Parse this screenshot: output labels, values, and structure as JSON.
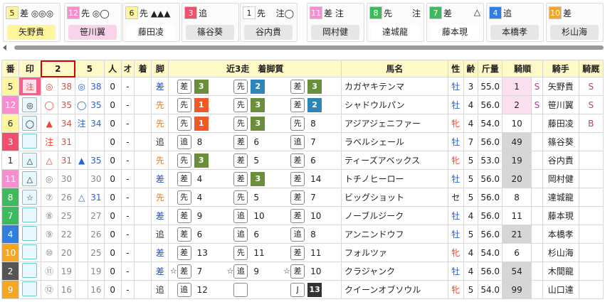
{
  "cards": [
    {
      "num": "5",
      "num_color": "#fff59d",
      "marks": "差 ◎◎◎",
      "jockey": "矢野貴",
      "jockey_bg": "#fff59d",
      "right": ""
    },
    {
      "num": "12",
      "num_color": "#f88ed0",
      "marks": "先 ◎◯",
      "jockey": "笹川翼",
      "jockey_bg": "#f9d3ea",
      "right": ""
    },
    {
      "num": "6",
      "num_color": "#fff59d",
      "marks": "先 ▲▲▲",
      "jockey": "藤田凌",
      "jockey_bg": "#fff",
      "right": ""
    },
    {
      "num": "3",
      "num_color": "#f0506e",
      "marks": "追",
      "jockey": "篠谷葵",
      "jockey_bg": "#e6e6e6",
      "right": ""
    },
    {
      "num": "1",
      "num_color": "#fff",
      "marks": "先",
      "jockey": "谷内貴",
      "jockey_bg": "#e6e6e6",
      "right": "注◯"
    },
    {
      "num": "11",
      "num_color": "#f88ed0",
      "marks": "差 注",
      "jockey": "岡村健",
      "jockey_bg": "#e6e6e6",
      "right": ""
    },
    {
      "num": "8",
      "num_color": "#3dbb5c",
      "marks": "先",
      "jockey": "達城龍",
      "jockey_bg": "#fff",
      "right": "注"
    },
    {
      "num": "7",
      "num_color": "#3dbb5c",
      "marks": "差",
      "jockey": "藤本現",
      "jockey_bg": "#fff",
      "right": "△"
    },
    {
      "num": "4",
      "num_color": "#2f7ee0",
      "marks": "追",
      "jockey": "本橋孝",
      "jockey_bg": "#e6e6e6",
      "right": ""
    },
    {
      "num": "10",
      "num_color": "#f5a623",
      "marks": "差",
      "jockey": "杉山海",
      "jockey_bg": "#e6e6e6",
      "right": ""
    }
  ],
  "headers": {
    "ban": "番",
    "shirushi": "印",
    "c2": "2",
    "c4": "",
    "c5": "5",
    "c6": "",
    "ninki": "人",
    "o": "オ",
    "chaku": "着",
    "kyaku": "脚",
    "kinsou": "近3走　着脚質",
    "bamei": "馬名",
    "sei": "性",
    "rei": "齢",
    "kinryo": "斤量",
    "kijun": "騎順",
    "kishu": "騎手",
    "kiyu": "騎厩"
  },
  "rows": [
    {
      "ban": "5",
      "ban_bg": "#fff59d",
      "ban_fg": "#222",
      "shirushi": "注",
      "shirushi_cls": "red",
      "shirushi_bg": "#ff5a8a",
      "m1": "◎",
      "m1c": "red",
      "v1": "38",
      "v1c": "red",
      "m2": "◎",
      "m2c": "blue",
      "v2": "38",
      "v2c": "blue",
      "ninki": "0",
      "o": "-",
      "kyaku": "差",
      "kyakuc": "kyaku-sa",
      "r": [
        {
          "st": "",
          "k": "差",
          "b": "3",
          "bc": "b-sa"
        },
        {
          "st": "",
          "k": "先",
          "b": "2",
          "bc": "b-zai"
        },
        {
          "st": "",
          "k": "差",
          "b": "3",
          "bc": "b-sa"
        }
      ],
      "bamei": "カガヤキテンマ",
      "sei": "牡",
      "seic": "blue",
      "rei": "3",
      "kinryo": "55.0",
      "kijun": "1",
      "kijunbg": "#fde0f0",
      "s": "S",
      "kishu": "矢野貴",
      "kiyu": "S"
    },
    {
      "ban": "12",
      "ban_bg": "#f88ed0",
      "ban_fg": "#fff",
      "shirushi": "◎",
      "shirushi_cls": "",
      "shirushi_bg": "#fff",
      "m1": "◯",
      "m1c": "red",
      "v1": "35",
      "v1c": "red",
      "m2": "◯",
      "m2c": "blue",
      "v2": "35",
      "v2c": "blue",
      "ninki": "0",
      "o": "-",
      "kyaku": "先",
      "kyakuc": "kyaku-se",
      "r": [
        {
          "st": "",
          "k": "先",
          "b": "1",
          "bc": "b-se"
        },
        {
          "st": "",
          "k": "先",
          "b": "3",
          "bc": "b-sa"
        },
        {
          "st": "",
          "k": "差",
          "b": "2",
          "bc": "b-zai"
        }
      ],
      "bamei": "シャドウルパン",
      "sei": "牡",
      "seic": "blue",
      "rei": "4",
      "kinryo": "56.0",
      "kijun": "2",
      "kijunbg": "#fde0f0",
      "s": "S",
      "kishu": "笹川翼",
      "kiyu": "S"
    },
    {
      "ban": "6",
      "ban_bg": "#fff59d",
      "ban_fg": "#222",
      "shirushi": "◯",
      "shirushi_cls": "",
      "shirushi_bg": "#fff",
      "m1": "▲",
      "m1c": "red",
      "v1": "34",
      "v1c": "red",
      "m2": "注",
      "m2c": "blue",
      "v2": "34",
      "v2c": "blue",
      "ninki": "0",
      "o": "-",
      "kyaku": "先",
      "kyakuc": "kyaku-se",
      "r": [
        {
          "st": "",
          "k": "先",
          "b": "1",
          "bc": "b-se"
        },
        {
          "st": "",
          "k": "先",
          "b": "3",
          "bc": "b-sa"
        },
        {
          "st": "",
          "k": "先",
          "b": "8",
          "bc": ""
        }
      ],
      "bamei": "アジアジェニファー",
      "sei": "牝",
      "seic": "red",
      "rei": "4",
      "kinryo": "54.0",
      "kijun": "10",
      "kijunbg": "#fff",
      "s": "",
      "kishu": "藤田凌",
      "kiyu": "B"
    },
    {
      "ban": "3",
      "ban_bg": "#f0506e",
      "ban_fg": "#fff",
      "shirushi": "",
      "shirushi_cls": "",
      "shirushi_bg": "#fff",
      "m1": "注",
      "m1c": "red",
      "v1": "31",
      "v1c": "red",
      "m2": "",
      "m2c": "",
      "v2": "",
      "v2c": "",
      "ninki": "0",
      "o": "-",
      "kyaku": "追",
      "kyakuc": "kyaku-oi",
      "r": [
        {
          "st": "",
          "k": "追",
          "b": "8",
          "bc": ""
        },
        {
          "st": "",
          "k": "差",
          "b": "6",
          "bc": ""
        },
        {
          "st": "",
          "k": "追",
          "b": "7",
          "bc": ""
        }
      ],
      "bamei": "ラベルシェール",
      "sei": "牡",
      "seic": "blue",
      "rei": "7",
      "kinryo": "56.0",
      "kijun": "49",
      "kijunbg": "#d6d6d6",
      "s": "",
      "kishu": "篠谷葵",
      "kiyu": ""
    },
    {
      "ban": "1",
      "ban_bg": "#fff",
      "ban_fg": "#222",
      "shirushi": "△",
      "shirushi_cls": "",
      "shirushi_bg": "#fff",
      "m1": "△",
      "m1c": "red",
      "v1": "31",
      "v1c": "red",
      "m2": "▲",
      "m2c": "blue",
      "v2": "35",
      "v2c": "blue",
      "ninki": "0",
      "o": "-",
      "kyaku": "先",
      "kyakuc": "kyaku-se",
      "r": [
        {
          "st": "",
          "k": "先",
          "b": "3",
          "bc": "b-sa"
        },
        {
          "st": "",
          "k": "差",
          "b": "5",
          "bc": ""
        },
        {
          "st": "",
          "k": "差",
          "b": "6",
          "bc": ""
        }
      ],
      "bamei": "ティーズアベックス",
      "sei": "牝",
      "seic": "red",
      "rei": "5",
      "kinryo": "53.0",
      "kijun": "19",
      "kijunbg": "#d6d6d6",
      "s": "",
      "kishu": "谷内貴",
      "kiyu": ""
    },
    {
      "ban": "11",
      "ban_bg": "#f88ed0",
      "ban_fg": "#fff",
      "shirushi": "△",
      "shirushi_cls": "",
      "shirushi_bg": "#fff",
      "m1": "◎",
      "m1c": "gray",
      "v1": "30",
      "v1c": "gray",
      "m2": "",
      "m2c": "",
      "v2": "30",
      "v2c": "gray",
      "ninki": "0",
      "o": "-",
      "kyaku": "差",
      "kyakuc": "kyaku-sa",
      "r": [
        {
          "st": "",
          "k": "差",
          "b": "4",
          "bc": ""
        },
        {
          "st": "",
          "k": "差",
          "b": "3",
          "bc": "b-sa"
        },
        {
          "st": "",
          "k": "差",
          "b": "14",
          "bc": ""
        }
      ],
      "bamei": "トチノヒーロー",
      "sei": "牡",
      "seic": "blue",
      "rei": "5",
      "kinryo": "56.0",
      "kijun": "20",
      "kijunbg": "#d6d6d6",
      "s": "",
      "kishu": "岡村健",
      "kiyu": ""
    },
    {
      "ban": "8",
      "ban_bg": "#3dbb5c",
      "ban_fg": "#fff",
      "shirushi": "☆",
      "shirushi_cls": "",
      "shirushi_bg": "#fff",
      "m1": "⑦",
      "m1c": "gray",
      "v1": "26",
      "v1c": "gray",
      "m2": "△",
      "m2c": "blue",
      "v2": "31",
      "v2c": "blue",
      "ninki": "0",
      "o": "-",
      "kyaku": "先",
      "kyakuc": "kyaku-se",
      "r": [
        {
          "st": "",
          "k": "先",
          "b": "4",
          "bc": ""
        },
        {
          "st": "",
          "k": "先",
          "b": "5",
          "bc": ""
        },
        {
          "st": "",
          "k": "差",
          "b": "7",
          "bc": ""
        }
      ],
      "bamei": "ビッグショット",
      "sei": "セ",
      "seic": "",
      "rei": "5",
      "kinryo": "56.0",
      "kijun": "8",
      "kijunbg": "#fff",
      "s": "",
      "kishu": "達城龍",
      "kiyu": ""
    },
    {
      "ban": "7",
      "ban_bg": "#3dbb5c",
      "ban_fg": "#fff",
      "shirushi": "",
      "shirushi_cls": "",
      "shirushi_bg": "#fff",
      "m1": "⑧",
      "m1c": "gray",
      "v1": "25",
      "v1c": "gray",
      "m2": "",
      "m2c": "",
      "v2": "27",
      "v2c": "gray",
      "ninki": "0",
      "o": "-",
      "kyaku": "差",
      "kyakuc": "kyaku-sa",
      "r": [
        {
          "st": "",
          "k": "差",
          "b": "9",
          "bc": ""
        },
        {
          "st": "",
          "k": "追",
          "b": "10",
          "bc": ""
        },
        {
          "st": "",
          "k": "差",
          "b": "10",
          "bc": ""
        }
      ],
      "bamei": "ノーブルジーク",
      "sei": "牡",
      "seic": "blue",
      "rei": "4",
      "kinryo": "56.0",
      "kijun": "11",
      "kijunbg": "#fff",
      "s": "",
      "kishu": "藤本現",
      "kiyu": ""
    },
    {
      "ban": "4",
      "ban_bg": "#2f7ee0",
      "ban_fg": "#fff",
      "shirushi": "",
      "shirushi_cls": "",
      "shirushi_bg": "#fff",
      "m1": "⑨",
      "m1c": "gray",
      "v1": "22",
      "v1c": "gray",
      "m2": "",
      "m2c": "",
      "v2": "26",
      "v2c": "gray",
      "ninki": "0",
      "o": "-",
      "kyaku": "追",
      "kyakuc": "kyaku-oi",
      "r": [
        {
          "st": "",
          "k": "差",
          "b": "6",
          "bc": ""
        },
        {
          "st": "",
          "k": "追",
          "b": "6",
          "bc": ""
        },
        {
          "st": "",
          "k": "追",
          "b": "8",
          "bc": ""
        }
      ],
      "bamei": "アンニンドウフ",
      "sei": "牡",
      "seic": "blue",
      "rei": "5",
      "kinryo": "56.0",
      "kijun": "21",
      "kijunbg": "#d6d6d6",
      "s": "",
      "kishu": "本橋孝",
      "kiyu": ""
    },
    {
      "ban": "10",
      "ban_bg": "#f5a623",
      "ban_fg": "#fff",
      "shirushi": "",
      "shirushi_cls": "",
      "shirushi_bg": "#fff",
      "m1": "⑩",
      "m1c": "gray",
      "v1": "20",
      "v1c": "gray",
      "m2": "",
      "m2c": "",
      "v2": "25",
      "v2c": "gray",
      "ninki": "0",
      "o": "-",
      "kyaku": "差",
      "kyakuc": "kyaku-sa",
      "r": [
        {
          "st": "",
          "k": "差",
          "b": "13",
          "bc": ""
        },
        {
          "st": "",
          "k": "先",
          "b": "11",
          "bc": ""
        },
        {
          "st": "",
          "k": "差",
          "b": "11",
          "bc": ""
        }
      ],
      "bamei": "フォルツァ",
      "sei": "牝",
      "seic": "red",
      "rei": "4",
      "kinryo": "54.0",
      "kijun": "6",
      "kijunbg": "#fff",
      "s": "",
      "kishu": "杉山海",
      "kiyu": ""
    },
    {
      "ban": "2",
      "ban_bg": "#555",
      "ban_fg": "#fff",
      "shirushi": "",
      "shirushi_cls": "",
      "shirushi_bg": "#fff",
      "m1": "⑪",
      "m1c": "gray",
      "v1": "19",
      "v1c": "gray",
      "m2": "",
      "m2c": "",
      "v2": "19",
      "v2c": "gray",
      "ninki": "0",
      "o": "-",
      "kyaku": "差",
      "kyakuc": "kyaku-sa",
      "r": [
        {
          "st": "☆",
          "k": "差",
          "b": "7",
          "bc": ""
        },
        {
          "st": "☆",
          "k": "追",
          "b": "9",
          "bc": ""
        },
        {
          "st": "☆",
          "k": "差",
          "b": "10",
          "bc": ""
        }
      ],
      "bamei": "クラジャンク",
      "sei": "牡",
      "seic": "blue",
      "rei": "4",
      "kinryo": "56.0",
      "kijun": "54",
      "kijunbg": "#d6d6d6",
      "s": "",
      "kishu": "木間龍",
      "kiyu": ""
    },
    {
      "ban": "9",
      "ban_bg": "#f5a623",
      "ban_fg": "#fff",
      "shirushi": "",
      "shirushi_cls": "",
      "shirushi_bg": "#fff",
      "m1": "⑫",
      "m1c": "gray",
      "v1": "16",
      "v1c": "gray",
      "m2": "",
      "m2c": "",
      "v2": "16",
      "v2c": "gray",
      "ninki": "0",
      "o": "-",
      "kyaku": "追",
      "kyakuc": "kyaku-oi",
      "r": [
        {
          "st": "",
          "k": "追",
          "b": "12",
          "bc": ""
        },
        {
          "st": "",
          "k": "",
          "b": "",
          "bc": ""
        },
        {
          "st": "",
          "k": "J",
          "b": "13",
          "bc": "b-j"
        }
      ],
      "bamei": "クイーンオブソウル",
      "sei": "牝",
      "seic": "red",
      "rei": "5",
      "kinryo": "54.0",
      "kijun": "99",
      "kijunbg": "#d6d6d6",
      "s": "",
      "kishu": "山口達",
      "kiyu": ""
    }
  ]
}
